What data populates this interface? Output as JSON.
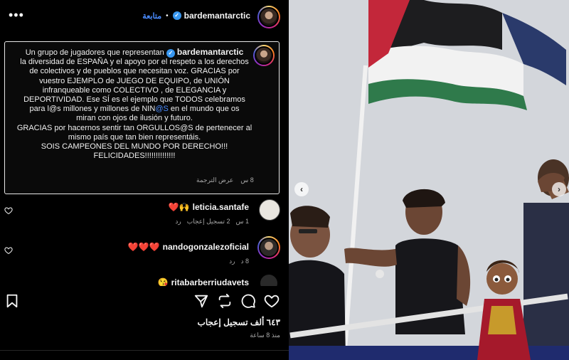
{
  "header": {
    "username": "bardemantarctic",
    "follow_label": "متابعة",
    "separator": "•",
    "more_label": "•••"
  },
  "caption": {
    "username": "bardemantarctic",
    "lines": {
      "l1_prefix": "Un grupo de jugadores que representan",
      "l2": "la diversidad de ESPAÑA y el apoyo por el respeto a los derechos",
      "l3": "de colectivos y de pueblos que necesitan voz. GRACIAS por",
      "l4": "vuestro EJEMPLO de JUEGO DE EQUIPO, de UNIÓN",
      "l5": "infranqueable como COLECTIVO , de ELEGANCIA y",
      "l6": "DEPORTIVIDAD. Ese SÍ es el ejemplo que TODOS celebramos",
      "l7_a": "para l@s millones y millones de NIN",
      "l7_mention": "@S",
      "l7_b": " en el mundo que os",
      "l8": "miran con ojos de ilusión y futuro.",
      "l9": "GRACIAS por hacernos sentir tan ORGULLOS@S de pertenecer al",
      "l10": "mismo país que tan bien representáis.",
      "l11": "SOIS CAMPEONES DEL MUNDO POR DERECHO!!!",
      "l12": "FELICIDADES!!!!!!!!!!!!!!"
    },
    "time": "8 س",
    "translate_label": "عرض الترجمة"
  },
  "comments": [
    {
      "username": "leticia.santafe",
      "text": "❤️🙌",
      "time": "1 س",
      "likes": "2 تسجيل إعجاب",
      "reply": "رد"
    },
    {
      "username": "nandogonzalezoficial",
      "text": "❤️❤️❤️",
      "time": "8 د",
      "reply": "رد"
    },
    {
      "username": "ritabarberriudavets",
      "text": "😘"
    }
  ],
  "actions": {
    "like_count": "٦٤٣ ألف تسجيل إعجاب",
    "time_ago": "منذ 8 ساعة"
  },
  "colors": {
    "background": "#000000",
    "accent_blue": "#4a8cff",
    "verified_blue": "#3897f0",
    "muted_text": "#a8a8a8",
    "heart_red": "#ed4956"
  }
}
